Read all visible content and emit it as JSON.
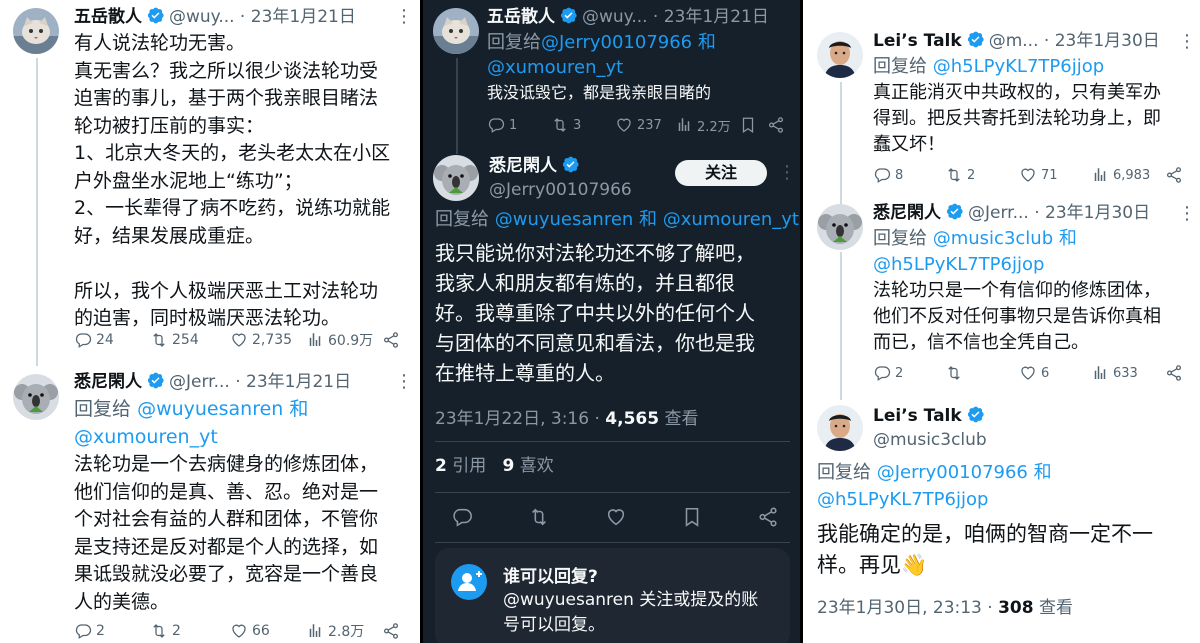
{
  "colors": {
    "link": "#1d9bf0",
    "verified": "#1d9bf0",
    "dark_bg": "#15202b",
    "light_bg": "#ffffff"
  },
  "panel1": {
    "tweet1": {
      "name": "五岳散人",
      "handle": "@wuy...",
      "date": "23年1月21日",
      "lines": [
        "有人说法轮功无害。",
        "真无害么？我之所以很少谈法轮功受",
        "迫害的事儿，基于两个我亲眼目睹法",
        "轮功被打压前的事实：",
        "1、北京大冬天的，老头老太太在小区",
        "户外盘坐水泥地上“练功”；",
        "2、一长辈得了病不吃药，说练功就能",
        "好，结果发展成重症。",
        "",
        "所以，我个人极端厌恶土工对法轮功",
        "的迫害，同时极端厌恶法轮功。"
      ],
      "replies": "24",
      "retweets": "254",
      "likes": "2,735",
      "views": "60.9万"
    },
    "tweet2": {
      "name": "悉尼閑人",
      "handle": "@Jerr...",
      "date": "23年1月21日",
      "reply_prefix": "回复给",
      "reply_to1": "@wuyuesanren",
      "reply_and": "和",
      "reply_to2": "@xumouren_yt",
      "lines": [
        "法轮功是一个去病健身的修炼团体，",
        "他们信仰的是真、善、忍。绝对是一",
        "个对社会有益的人群和团体，不管你",
        "是支持还是反对都是个人的选择，如",
        "果诋毁就没必要了，宽容是一个善良",
        "人的美德。"
      ],
      "replies": "2",
      "retweets": "2",
      "likes": "66",
      "views": "2.8万"
    }
  },
  "panel2": {
    "tweet1": {
      "name": "五岳散人",
      "handle": "@wuy...",
      "date": "23年1月21日",
      "reply_prefix": "回复给",
      "reply_to1": "@Jerry00107966",
      "reply_and": "和",
      "reply_to2": "@xumouren_yt",
      "text": "我没诋毁它，都是我亲眼目睹的",
      "replies": "1",
      "retweets": "3",
      "likes": "237",
      "views": "2.2万"
    },
    "main": {
      "name": "悉尼閑人",
      "handle": "@Jerry00107966",
      "follow": "关注",
      "reply_prefix": "回复给",
      "reply_to1": "@wuyuesanren",
      "reply_and": "和",
      "reply_to2": "@xumouren_yt",
      "lines": [
        "我只能说你对法轮功还不够了解吧，",
        "我家人和朋友都有炼的，并且都很",
        "好。我尊重除了中共以外的任何个人",
        "与团体的不同意见和看法，你也是我",
        "在推特上尊重的人。"
      ],
      "timestamp": "23年1月22日, 3:16 · ",
      "views_count": "4,565",
      "views_label": " 查看",
      "quotes_count": "2",
      "quotes_label": " 引用",
      "likes_count": "9",
      "likes_label": " 喜欢"
    },
    "card": {
      "title": "谁可以回复?",
      "line1": "@wuyuesanren 关注或提及的账",
      "line2": "号可以回复。"
    }
  },
  "panel3": {
    "tweet1": {
      "name": "Lei’s Talk",
      "handle": "@m...",
      "date": "23年1月30日",
      "reply_prefix": "回复给",
      "reply_to1": "@h5LPyKL7TP6jjop",
      "lines": [
        "真正能消灭中共政权的，只有美军办",
        "得到。把反共寄托到法轮功身上，即",
        "蠢又坏！"
      ],
      "replies": "8",
      "retweets": "2",
      "likes": "71",
      "views": "6,983"
    },
    "tweet2": {
      "name": "悉尼閑人",
      "handle": "@Jerr...",
      "date": "23年1月30日",
      "reply_prefix": "回复给",
      "reply_to1": "@music3club",
      "reply_and": "和",
      "reply_to2": "@h5LPyKL7TP6jjop",
      "lines": [
        "法轮功只是一个有信仰的修炼团体，",
        "他们不反对任何事物只是告诉你真相",
        "而已，信不信也全凭自己。"
      ],
      "replies": "2",
      "retweets": "",
      "likes": "6",
      "views": "633"
    },
    "main": {
      "name": "Lei’s Talk",
      "handle": "@music3club",
      "reply_prefix": "回复给",
      "reply_to1": "@Jerry00107966",
      "reply_and": "和",
      "reply_to2": "@h5LPyKL7TP6jjop",
      "lines": [
        "我能确定的是，咱俩的智商一定不一",
        "样。再见👋"
      ],
      "timestamp": "23年1月30日, 23:13 · ",
      "views_count": "308",
      "views_label": " 查看"
    }
  }
}
